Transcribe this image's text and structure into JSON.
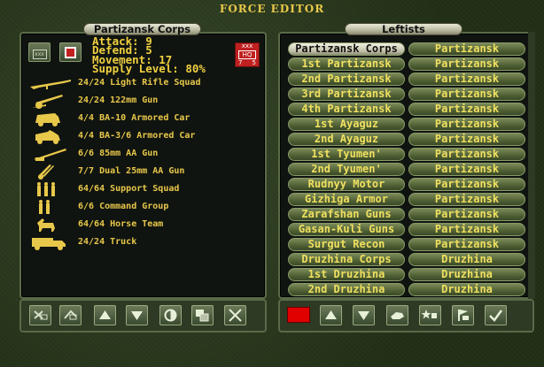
{
  "window": {
    "title": "FORCE EDITOR"
  },
  "left_panel": {
    "header": "Partizansk Corps",
    "stats": [
      "Attack: 9",
      "Defend: 5",
      "Movement: 17",
      "Supply Level: 80%"
    ],
    "hq_badge": {
      "top": "xxx",
      "label": "HQ",
      "left_num": "7",
      "right_num": "5"
    },
    "corps_symbol": "xxx",
    "units": [
      {
        "label": "24/24 Light Rifle Squad",
        "icon": "rifle-icon"
      },
      {
        "label": "24/24 122mm Gun",
        "icon": "artillery-gun-icon"
      },
      {
        "label": "4/4 BA-10 Armored Car",
        "icon": "armored-car-icon"
      },
      {
        "label": "4/4 BA-3/6 Armored Car",
        "icon": "armored-car-icon"
      },
      {
        "label": "6/6 85mm AA Gun",
        "icon": "aa-gun-icon"
      },
      {
        "label": "7/7 Dual 25mm AA Gun",
        "icon": "dual-aa-gun-icon"
      },
      {
        "label": "64/64 Support Squad",
        "icon": "support-squad-icon"
      },
      {
        "label": "6/6 Command Group",
        "icon": "command-group-icon"
      },
      {
        "label": "64/64 Horse Team",
        "icon": "horse-team-icon"
      },
      {
        "label": "24/24 Truck",
        "icon": "truck-icon"
      }
    ]
  },
  "right_panel": {
    "header": "Leftists",
    "formations": [
      {
        "name": "Partizansk Corps",
        "force": "Partizansk",
        "active": true
      },
      {
        "name": "1st Partizansk",
        "force": "Partizansk"
      },
      {
        "name": "2nd Partizansk",
        "force": "Partizansk"
      },
      {
        "name": "3rd Partizansk",
        "force": "Partizansk"
      },
      {
        "name": "4th Partizansk",
        "force": "Partizansk"
      },
      {
        "name": "1st Ayaguz",
        "force": "Partizansk"
      },
      {
        "name": "2nd Ayaguz",
        "force": "Partizansk"
      },
      {
        "name": "1st Tyumen'",
        "force": "Partizansk"
      },
      {
        "name": "2nd Tyumen'",
        "force": "Partizansk"
      },
      {
        "name": "Rudnyy Motor",
        "force": "Partizansk"
      },
      {
        "name": "Gizhiga Armor",
        "force": "Partizansk"
      },
      {
        "name": "Zarafshan Guns",
        "force": "Partizansk"
      },
      {
        "name": "Gasan-Kuli Guns",
        "force": "Partizansk"
      },
      {
        "name": "Surgut Recon",
        "force": "Partizansk"
      },
      {
        "name": "Druzhina Corps",
        "force": "Druzhina"
      },
      {
        "name": "1st Druzhina",
        "force": "Druzhina"
      },
      {
        "name": "2nd Druzhina",
        "force": "Druzhina"
      }
    ]
  },
  "colors": {
    "accent_text": "#e8c84a",
    "stat_text": "#f0d040",
    "hq_red": "#c02020",
    "swatch_red": "#e00000"
  },
  "left_toolbar": [
    {
      "icon": "remove-unit-icon"
    },
    {
      "icon": "add-unit-icon"
    },
    {
      "icon": "arrow-up-icon"
    },
    {
      "icon": "arrow-down-icon"
    },
    {
      "icon": "half-circle-icon"
    },
    {
      "icon": "copy-icon"
    },
    {
      "icon": "close-icon"
    }
  ],
  "right_toolbar": [
    {
      "icon": "arrow-up-icon"
    },
    {
      "icon": "arrow-down-icon"
    },
    {
      "icon": "hand-icon"
    },
    {
      "icon": "star-flag-icon"
    },
    {
      "icon": "flag-icon"
    },
    {
      "icon": "checkmark-icon"
    }
  ]
}
